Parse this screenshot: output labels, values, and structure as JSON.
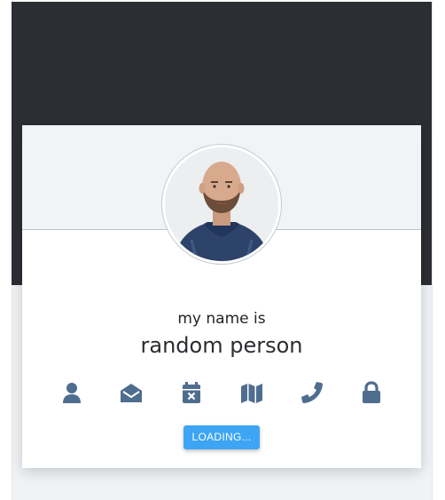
{
  "profile": {
    "label": "my name is",
    "value": "random person"
  },
  "icons": [
    {
      "name": "user-icon"
    },
    {
      "name": "envelope-open-icon"
    },
    {
      "name": "calendar-times-icon"
    },
    {
      "name": "map-icon"
    },
    {
      "name": "phone-icon"
    },
    {
      "name": "lock-icon"
    }
  ],
  "button": {
    "label": "LOADING..."
  },
  "colors": {
    "banner": "#2c2e33",
    "icon": "#4f6d8f",
    "button": "#3da5f4",
    "page": "#f0f3f6"
  }
}
